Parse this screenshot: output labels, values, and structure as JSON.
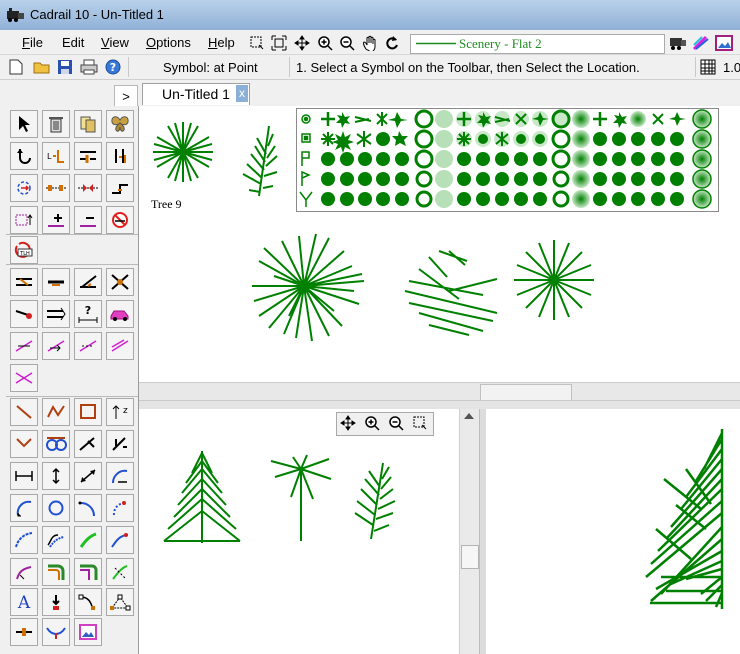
{
  "window": {
    "title": "Cadrail 10 - Un-Titled 1"
  },
  "menu": [
    {
      "label": "File",
      "accel": "F"
    },
    {
      "label": "Edit",
      "accel": ""
    },
    {
      "label": "View",
      "accel": "V"
    },
    {
      "label": "Options",
      "accel": "O"
    },
    {
      "label": "Help",
      "accel": "H"
    }
  ],
  "toolbar": {
    "layer_label": "Scenery - Flat 2",
    "layer_color": "#1e8c1e",
    "symbol_mode": "Symbol: at Point",
    "instruction": "1. Select a Symbol on the Toolbar, then Select the Location.",
    "trailing_value": "1.0"
  },
  "tabs": {
    "arrow": ">",
    "active": "Un-Titled 1",
    "close": "x"
  },
  "canvas": {
    "selected_symbol_label": "Tree 9",
    "drawing_color": "#008000"
  },
  "colors": {
    "accent": "#008000",
    "palette_bg": "#f0f0f0"
  }
}
